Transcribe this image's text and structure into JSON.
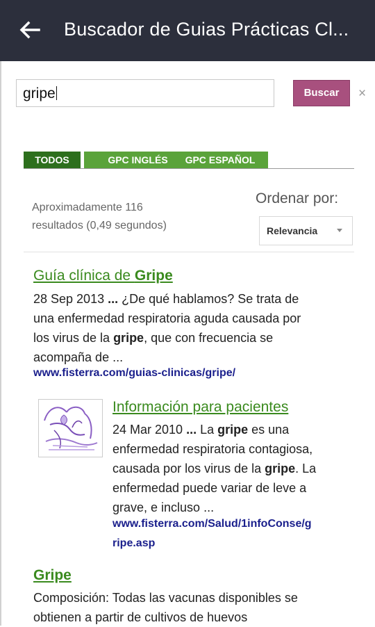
{
  "appbar": {
    "title": "Buscador de Guias Prácticas Cl..."
  },
  "search": {
    "value": "gripe",
    "button_label": "Buscar",
    "clear_label": "×"
  },
  "tabs": [
    {
      "label": "TODOS",
      "color": "#2d6f1d"
    },
    {
      "label": "GPC INGLÉS",
      "color": "#5aa33a"
    },
    {
      "label": "GPC ESPAÑOL",
      "color": "#5aa33a"
    }
  ],
  "results_stats": {
    "line1": "Aproximadamente 116",
    "line2": "resultados (0,49 segundos)"
  },
  "sort": {
    "label": "Ordenar por:",
    "selected": "Relevancia"
  },
  "results": [
    {
      "title_prefix": "Guía clínica de ",
      "title_bold": "Gripe",
      "snippet": [
        [
          "28 Sep 2013 ",
          "...",
          " ¿De qué hablamos? Se trata de"
        ],
        [
          "una enfermedad respiratoria aguda causada por"
        ],
        [
          "los virus de la ",
          "gripe",
          ", que con frecuencia se"
        ],
        [
          "acompaña de ..."
        ]
      ],
      "url": "www.fisterra.com/guias-clinicas/gripe/"
    },
    {
      "title": "Información para pacientes",
      "snippet": [
        [
          "24 Mar 2010 ",
          "...",
          " La ",
          "gripe",
          " es una"
        ],
        [
          "enfermedad respiratoria contagiosa,"
        ],
        [
          "causada por los virus de la ",
          "gripe",
          ". La"
        ],
        [
          "enfermedad puede variar de leve a"
        ],
        [
          "grave, e incluso ..."
        ]
      ],
      "url_line1": "www.fisterra.com/Salud/1infoConse/g",
      "url_line2": "ripe.asp"
    },
    {
      "title": "Gripe",
      "snippet": [
        [
          "Composición: Todas las vacunas disponibles se"
        ],
        [
          "obtienen a partir de cultivos de huevos"
        ]
      ]
    }
  ],
  "colors": {
    "appbar": "#2c2f3c",
    "accent_button": "#a8507e",
    "link_green": "#3a8a1e",
    "url_blue": "#1a1f8c"
  }
}
